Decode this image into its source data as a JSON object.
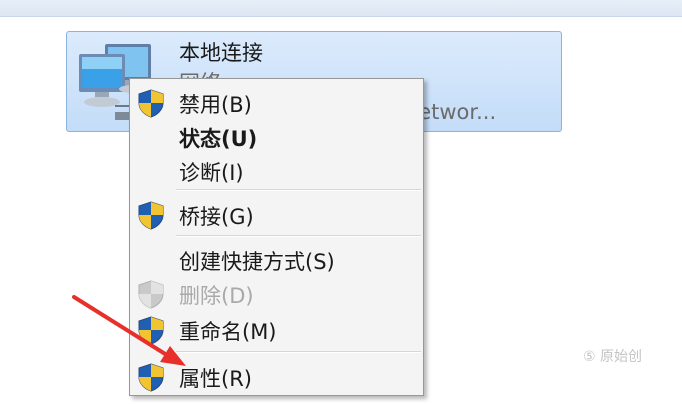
{
  "adapter": {
    "name": "本地连接",
    "status": "网络",
    "device": "T Networ..."
  },
  "context_menu": {
    "items": [
      {
        "label": "禁用(B)",
        "icon": "uac-shield-icon"
      },
      {
        "label": "状态(U)",
        "style": "bold"
      },
      {
        "label": "诊断(I)"
      },
      {
        "label": "桥接(G)",
        "icon": "uac-shield-icon"
      },
      {
        "label": "创建快捷方式(S)"
      },
      {
        "label": "删除(D)",
        "icon": "uac-shield-icon",
        "state": "disabled"
      },
      {
        "label": "重命名(M)",
        "icon": "uac-shield-icon"
      },
      {
        "label": "属性(R)",
        "icon": "uac-shield-icon"
      }
    ]
  },
  "annotation": {
    "arrow_color": "#e8302a"
  },
  "watermark": {
    "text": "⑤ 原始创"
  }
}
